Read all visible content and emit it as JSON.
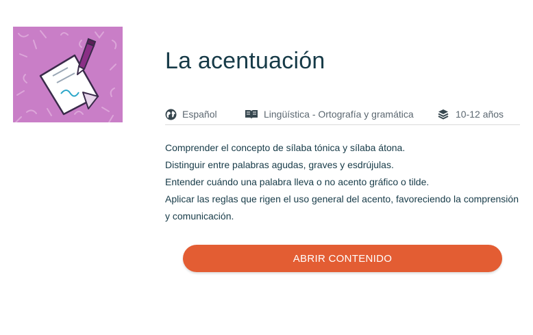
{
  "card": {
    "thumbnail_icon": "signed-document-pencil-illustration",
    "title": "La acentuación",
    "meta": {
      "language": {
        "icon": "globe-icon",
        "label": "Español"
      },
      "subject": {
        "icon": "open-book-icon",
        "label": "Lingüística - Ortografía y gramática"
      },
      "age": {
        "icon": "layers-icon",
        "label": "10-12 años"
      }
    },
    "objectives": [
      "Comprender el concepto de sílaba tónica y sílaba átona.",
      "Distinguir entre palabras agudas, graves y esdrújulas.",
      "Entender cuándo una palabra lleva o no acento gráfico o tilde.",
      "Aplicar las reglas que rigen el uso general del acento, favoreciendo la comprensión y comunicación."
    ],
    "button_label": "ABRIR CONTENIDO"
  },
  "colors": {
    "thumbnail_bg": "#c97ec7",
    "title": "#163a47",
    "meta_text": "#5b6770",
    "button_bg": "#e35d33",
    "button_text": "#ffffff"
  }
}
